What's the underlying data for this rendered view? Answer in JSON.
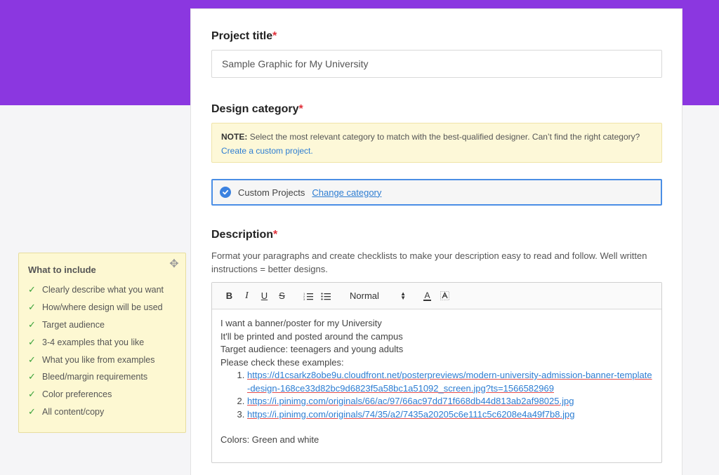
{
  "colors": {
    "banner": "#8b37e0",
    "required": "#e0303a",
    "link": "#2d7dd2",
    "selected_border": "#4a8ee5"
  },
  "form": {
    "project_title": {
      "label": "Project title",
      "required_mark": "*",
      "value": "Sample Graphic for My University"
    },
    "design_category": {
      "label": "Design category",
      "required_mark": "*",
      "note_prefix": "NOTE:",
      "note_text": "Select the most relevant category to match with the best-qualified designer. Can’t find the right category?",
      "note_link": "Create a custom project.",
      "selected": "Custom Projects",
      "change_link": "Change category",
      "selected_icon": "check-circle-icon"
    },
    "description": {
      "label": "Description",
      "required_mark": "*",
      "help": "Format your paragraphs and create checklists to make your description easy to read and follow. Well written instructions = better designs.",
      "toolbar": {
        "bold": "B",
        "italic": "I",
        "underline": "U",
        "strike": "S",
        "size_select": "Normal",
        "text_color": "A"
      },
      "lines": [
        "I want a banner/poster for my University",
        "It'll be printed and posted around the campus",
        "Target audience: teenagers and young adults",
        "Please check these examples:"
      ],
      "links": [
        "https://d1csarkz8obe9u.cloudfront.net/posterpreviews/modern-university-admission-banner-template-design-168ce33d82bc9d6823f5a58bc1a51092_screen.jpg?ts=1566582969",
        "https://i.pinimg.com/originals/66/ac/97/66ac97dd71f668db44d813ab2af98025.jpg",
        "https://i.pinimg.com/originals/74/35/a2/7435a20205c6e111c5c6208e4a49f7b8.jpg"
      ],
      "closing": "Colors: Green and white"
    }
  },
  "sidebar": {
    "title": "What to include",
    "move_icon": "move-icon",
    "items": [
      "Clearly describe what you want",
      "How/where design will be used",
      "Target audience",
      "3-4 examples that you like",
      "What you like from examples",
      "Bleed/margin requirements",
      "Color preferences",
      "All content/copy"
    ]
  }
}
